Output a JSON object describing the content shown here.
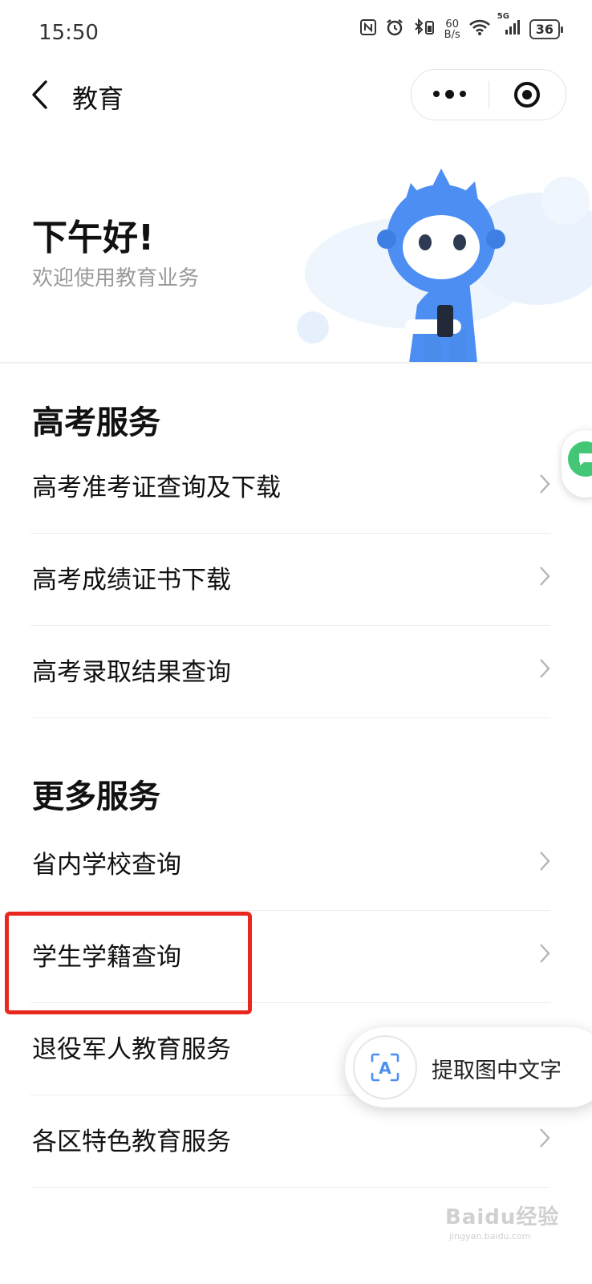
{
  "status_bar": {
    "time": "15:50",
    "net_speed_value": "60",
    "net_speed_unit": "B/s",
    "network": "5G",
    "battery": "36"
  },
  "nav": {
    "title": "教育",
    "back_icon": "chevron-left-icon",
    "more_icon": "more-dots-icon",
    "close_icon": "target-circle-icon"
  },
  "hero": {
    "greeting": "下午好!",
    "subtitle": "欢迎使用教育业务",
    "mascot": "blue-robot-mascot"
  },
  "sections": [
    {
      "title": "高考服务",
      "items": [
        {
          "label": "高考准考证查询及下载"
        },
        {
          "label": "高考成绩证书下载"
        },
        {
          "label": "高考录取结果查询"
        }
      ]
    },
    {
      "title": "更多服务",
      "items": [
        {
          "label": "省内学校查询"
        },
        {
          "label": "学生学籍查询",
          "highlighted": true
        },
        {
          "label": "退役军人教育服务"
        },
        {
          "label": "各区特色教育服务"
        }
      ]
    }
  ],
  "ocr_button": {
    "label": "提取图中文字",
    "icon": "scan-text-icon",
    "icon_letter": "A"
  },
  "watermark": {
    "text": "Baidu经验",
    "sub": "jingyan.baidu.com"
  },
  "colors": {
    "highlight": "#e8281f",
    "mascot_blue": "#4c8ef2",
    "float_green": "#43c777"
  }
}
